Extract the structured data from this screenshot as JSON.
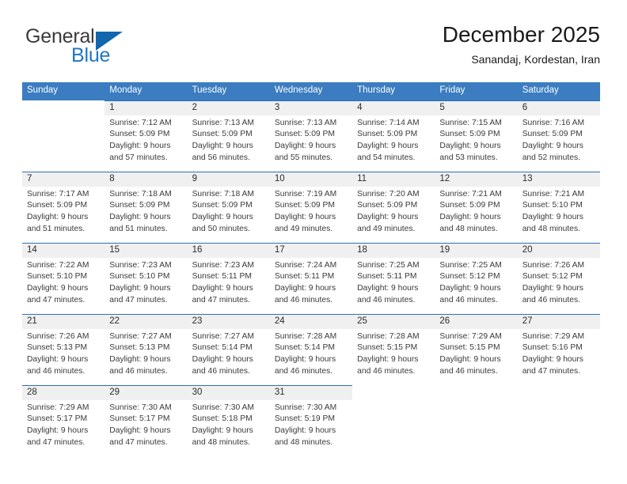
{
  "brand": {
    "name_top": "General",
    "name_bottom": "Blue",
    "triangle_icon": "triangle-icon",
    "color_dark": "#3b3b3b",
    "color_blue": "#1f76c4"
  },
  "header": {
    "title": "December 2025",
    "subtitle": "Sanandaj, Kordestan, Iran"
  },
  "theme": {
    "header_bar": "#3b7dc0",
    "row_rule": "#2f6fb5",
    "daynum_band": "#f0f0f0"
  },
  "weekday_headers": [
    "Sunday",
    "Monday",
    "Tuesday",
    "Wednesday",
    "Thursday",
    "Friday",
    "Saturday"
  ],
  "weeks": [
    [
      {
        "day": "",
        "sunrise": "",
        "sunset": "",
        "daylight_line1": "",
        "daylight_line2": "",
        "blank": true
      },
      {
        "day": "1",
        "sunrise": "Sunrise: 7:12 AM",
        "sunset": "Sunset: 5:09 PM",
        "daylight_line1": "Daylight: 9 hours",
        "daylight_line2": "and 57 minutes."
      },
      {
        "day": "2",
        "sunrise": "Sunrise: 7:13 AM",
        "sunset": "Sunset: 5:09 PM",
        "daylight_line1": "Daylight: 9 hours",
        "daylight_line2": "and 56 minutes."
      },
      {
        "day": "3",
        "sunrise": "Sunrise: 7:13 AM",
        "sunset": "Sunset: 5:09 PM",
        "daylight_line1": "Daylight: 9 hours",
        "daylight_line2": "and 55 minutes."
      },
      {
        "day": "4",
        "sunrise": "Sunrise: 7:14 AM",
        "sunset": "Sunset: 5:09 PM",
        "daylight_line1": "Daylight: 9 hours",
        "daylight_line2": "and 54 minutes."
      },
      {
        "day": "5",
        "sunrise": "Sunrise: 7:15 AM",
        "sunset": "Sunset: 5:09 PM",
        "daylight_line1": "Daylight: 9 hours",
        "daylight_line2": "and 53 minutes."
      },
      {
        "day": "6",
        "sunrise": "Sunrise: 7:16 AM",
        "sunset": "Sunset: 5:09 PM",
        "daylight_line1": "Daylight: 9 hours",
        "daylight_line2": "and 52 minutes."
      }
    ],
    [
      {
        "day": "7",
        "sunrise": "Sunrise: 7:17 AM",
        "sunset": "Sunset: 5:09 PM",
        "daylight_line1": "Daylight: 9 hours",
        "daylight_line2": "and 51 minutes."
      },
      {
        "day": "8",
        "sunrise": "Sunrise: 7:18 AM",
        "sunset": "Sunset: 5:09 PM",
        "daylight_line1": "Daylight: 9 hours",
        "daylight_line2": "and 51 minutes."
      },
      {
        "day": "9",
        "sunrise": "Sunrise: 7:18 AM",
        "sunset": "Sunset: 5:09 PM",
        "daylight_line1": "Daylight: 9 hours",
        "daylight_line2": "and 50 minutes."
      },
      {
        "day": "10",
        "sunrise": "Sunrise: 7:19 AM",
        "sunset": "Sunset: 5:09 PM",
        "daylight_line1": "Daylight: 9 hours",
        "daylight_line2": "and 49 minutes."
      },
      {
        "day": "11",
        "sunrise": "Sunrise: 7:20 AM",
        "sunset": "Sunset: 5:09 PM",
        "daylight_line1": "Daylight: 9 hours",
        "daylight_line2": "and 49 minutes."
      },
      {
        "day": "12",
        "sunrise": "Sunrise: 7:21 AM",
        "sunset": "Sunset: 5:09 PM",
        "daylight_line1": "Daylight: 9 hours",
        "daylight_line2": "and 48 minutes."
      },
      {
        "day": "13",
        "sunrise": "Sunrise: 7:21 AM",
        "sunset": "Sunset: 5:10 PM",
        "daylight_line1": "Daylight: 9 hours",
        "daylight_line2": "and 48 minutes."
      }
    ],
    [
      {
        "day": "14",
        "sunrise": "Sunrise: 7:22 AM",
        "sunset": "Sunset: 5:10 PM",
        "daylight_line1": "Daylight: 9 hours",
        "daylight_line2": "and 47 minutes."
      },
      {
        "day": "15",
        "sunrise": "Sunrise: 7:23 AM",
        "sunset": "Sunset: 5:10 PM",
        "daylight_line1": "Daylight: 9 hours",
        "daylight_line2": "and 47 minutes."
      },
      {
        "day": "16",
        "sunrise": "Sunrise: 7:23 AM",
        "sunset": "Sunset: 5:11 PM",
        "daylight_line1": "Daylight: 9 hours",
        "daylight_line2": "and 47 minutes."
      },
      {
        "day": "17",
        "sunrise": "Sunrise: 7:24 AM",
        "sunset": "Sunset: 5:11 PM",
        "daylight_line1": "Daylight: 9 hours",
        "daylight_line2": "and 46 minutes."
      },
      {
        "day": "18",
        "sunrise": "Sunrise: 7:25 AM",
        "sunset": "Sunset: 5:11 PM",
        "daylight_line1": "Daylight: 9 hours",
        "daylight_line2": "and 46 minutes."
      },
      {
        "day": "19",
        "sunrise": "Sunrise: 7:25 AM",
        "sunset": "Sunset: 5:12 PM",
        "daylight_line1": "Daylight: 9 hours",
        "daylight_line2": "and 46 minutes."
      },
      {
        "day": "20",
        "sunrise": "Sunrise: 7:26 AM",
        "sunset": "Sunset: 5:12 PM",
        "daylight_line1": "Daylight: 9 hours",
        "daylight_line2": "and 46 minutes."
      }
    ],
    [
      {
        "day": "21",
        "sunrise": "Sunrise: 7:26 AM",
        "sunset": "Sunset: 5:13 PM",
        "daylight_line1": "Daylight: 9 hours",
        "daylight_line2": "and 46 minutes."
      },
      {
        "day": "22",
        "sunrise": "Sunrise: 7:27 AM",
        "sunset": "Sunset: 5:13 PM",
        "daylight_line1": "Daylight: 9 hours",
        "daylight_line2": "and 46 minutes."
      },
      {
        "day": "23",
        "sunrise": "Sunrise: 7:27 AM",
        "sunset": "Sunset: 5:14 PM",
        "daylight_line1": "Daylight: 9 hours",
        "daylight_line2": "and 46 minutes."
      },
      {
        "day": "24",
        "sunrise": "Sunrise: 7:28 AM",
        "sunset": "Sunset: 5:14 PM",
        "daylight_line1": "Daylight: 9 hours",
        "daylight_line2": "and 46 minutes."
      },
      {
        "day": "25",
        "sunrise": "Sunrise: 7:28 AM",
        "sunset": "Sunset: 5:15 PM",
        "daylight_line1": "Daylight: 9 hours",
        "daylight_line2": "and 46 minutes."
      },
      {
        "day": "26",
        "sunrise": "Sunrise: 7:29 AM",
        "sunset": "Sunset: 5:15 PM",
        "daylight_line1": "Daylight: 9 hours",
        "daylight_line2": "and 46 minutes."
      },
      {
        "day": "27",
        "sunrise": "Sunrise: 7:29 AM",
        "sunset": "Sunset: 5:16 PM",
        "daylight_line1": "Daylight: 9 hours",
        "daylight_line2": "and 47 minutes."
      }
    ],
    [
      {
        "day": "28",
        "sunrise": "Sunrise: 7:29 AM",
        "sunset": "Sunset: 5:17 PM",
        "daylight_line1": "Daylight: 9 hours",
        "daylight_line2": "and 47 minutes."
      },
      {
        "day": "29",
        "sunrise": "Sunrise: 7:30 AM",
        "sunset": "Sunset: 5:17 PM",
        "daylight_line1": "Daylight: 9 hours",
        "daylight_line2": "and 47 minutes."
      },
      {
        "day": "30",
        "sunrise": "Sunrise: 7:30 AM",
        "sunset": "Sunset: 5:18 PM",
        "daylight_line1": "Daylight: 9 hours",
        "daylight_line2": "and 48 minutes."
      },
      {
        "day": "31",
        "sunrise": "Sunrise: 7:30 AM",
        "sunset": "Sunset: 5:19 PM",
        "daylight_line1": "Daylight: 9 hours",
        "daylight_line2": "and 48 minutes."
      },
      {
        "day": "",
        "sunrise": "",
        "sunset": "",
        "daylight_line1": "",
        "daylight_line2": "",
        "blank": true
      },
      {
        "day": "",
        "sunrise": "",
        "sunset": "",
        "daylight_line1": "",
        "daylight_line2": "",
        "blank": true
      },
      {
        "day": "",
        "sunrise": "",
        "sunset": "",
        "daylight_line1": "",
        "daylight_line2": "",
        "blank": true
      }
    ]
  ]
}
